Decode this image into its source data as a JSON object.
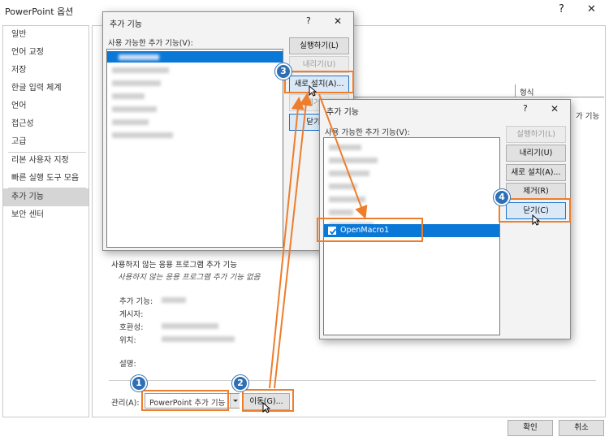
{
  "window": {
    "title": "PowerPoint 옵션",
    "help": "?",
    "close": "✕"
  },
  "sidebar": {
    "items": [
      {
        "label": "일반"
      },
      {
        "label": "언어 교정"
      },
      {
        "label": "저장"
      },
      {
        "label": "한글 입력 체계"
      },
      {
        "label": "언어"
      },
      {
        "label": "접근성"
      },
      {
        "label": "고급"
      },
      {
        "label": "리본 사용자 지정"
      },
      {
        "label": "빠른 실행 도구 모음"
      },
      {
        "label": "추가 기능"
      },
      {
        "label": "보안 센터"
      }
    ]
  },
  "main": {
    "table_header": "형식",
    "partial_text": "가 기능",
    "disabled_section_title": "사용하지 않는 응용 프로그램 추가 기능",
    "disabled_section_empty": "사용하지 않는 응용 프로그램 추가 기능 없음",
    "details": {
      "addin_label": "추가 기능:",
      "publisher_label": "게시자:",
      "compat_label": "호환성:",
      "location_label": "위치:",
      "desc_label": "설명:"
    },
    "manage_label": "관리(A):",
    "manage_value": "PowerPoint 추가 기능",
    "go_button": "이동(G)..."
  },
  "dialog1": {
    "title": "추가 기능",
    "help": "?",
    "close": "✕",
    "list_label": "사용 가능한 추가 기능(V):",
    "buttons": {
      "run": "실행하기(L)",
      "unload": "내리기(U)",
      "add_new": "새로 설치(A)...",
      "remove": "제거(R)",
      "close": "닫기(C)"
    }
  },
  "dialog2": {
    "title": "추가 기능",
    "help": "?",
    "close": "✕",
    "list_label": "사용 가능한 추가 기능(V):",
    "selected_item": "OpenMacro1",
    "buttons": {
      "run": "실행하기(L)",
      "unload": "내리기(U)",
      "add_new": "새로 설치(A)...",
      "remove": "제거(R)",
      "close": "닫기(C)"
    }
  },
  "footer": {
    "ok": "확인",
    "cancel": "취소"
  },
  "badges": [
    "1",
    "2",
    "3",
    "4"
  ],
  "colors": {
    "highlight": "#ee7d2c",
    "badge": "#2f6fb4",
    "selection": "#0a78d7"
  },
  "icons": [
    "checkbox-checked-icon",
    "dropdown-arrow-icon",
    "mouse-cursor-icon",
    "close-icon",
    "help-icon"
  ]
}
